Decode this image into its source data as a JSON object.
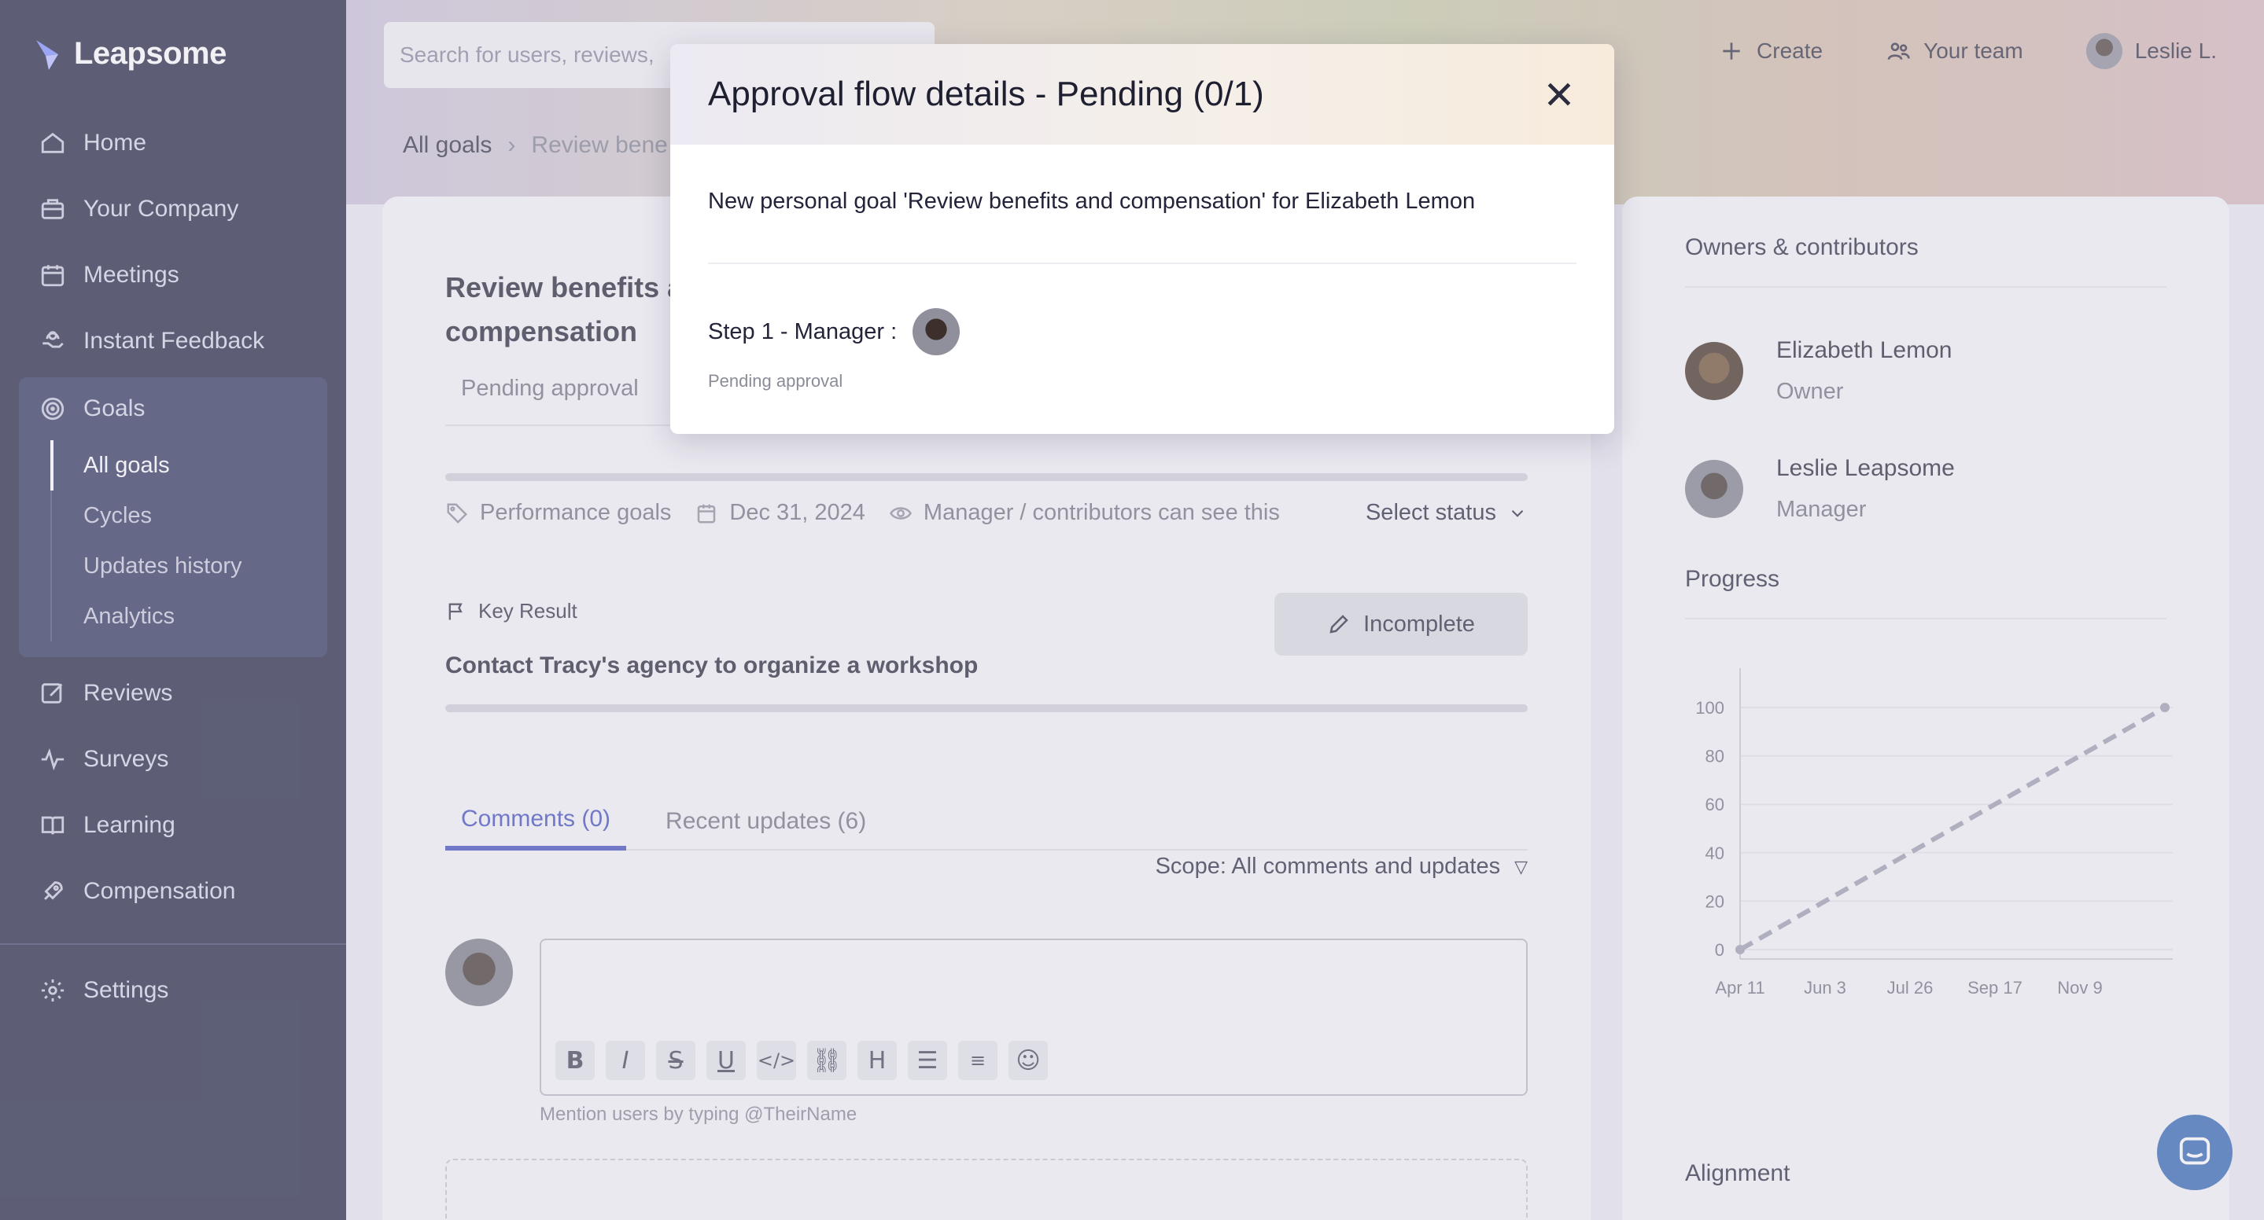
{
  "brand": {
    "name": "Leapsome"
  },
  "sidebar": {
    "items": [
      {
        "label": "Home",
        "icon": "home-icon"
      },
      {
        "label": "Your Company",
        "icon": "briefcase-icon"
      },
      {
        "label": "Meetings",
        "icon": "calendar-icon"
      },
      {
        "label": "Instant Feedback",
        "icon": "hand-icon"
      },
      {
        "label": "Goals",
        "icon": "target-icon"
      },
      {
        "label": "Reviews",
        "icon": "edit-icon"
      },
      {
        "label": "Surveys",
        "icon": "pulse-icon"
      },
      {
        "label": "Learning",
        "icon": "book-icon"
      },
      {
        "label": "Compensation",
        "icon": "rocket-icon"
      },
      {
        "label": "Settings",
        "icon": "gear-icon"
      }
    ],
    "goals_sub": [
      "All goals",
      "Cycles",
      "Updates history",
      "Analytics"
    ]
  },
  "header": {
    "search_placeholder": "Search for users, reviews,",
    "create": "Create",
    "your_team": "Your team",
    "user": "Leslie L."
  },
  "breadcrumb": {
    "root": "All goals",
    "current": "Review bene"
  },
  "goal": {
    "title": "Review benefits and compensation",
    "title_visible": "Review benefits ar compensation",
    "status_tab": "Pending approval",
    "meta": {
      "category": "Performance goals",
      "due_date": "Dec 31, 2024",
      "visibility": "Manager / contributors can see this",
      "select_status": "Select status"
    },
    "key_result": {
      "label": "Key Result",
      "title": "Contact Tracy's agency to organize a workshop",
      "button": "Incomplete"
    },
    "tabs": [
      {
        "label": "Comments (0)",
        "active": true
      },
      {
        "label": "Recent updates (6)",
        "active": false
      }
    ],
    "scope": "Scope: All comments and updates",
    "mention_hint": "Mention users by typing @TheirName"
  },
  "right_panel": {
    "owners_heading": "Owners & contributors",
    "people": [
      {
        "name": "Elizabeth Lemon",
        "role": "Owner"
      },
      {
        "name": "Leslie Leapsome",
        "role": "Manager"
      }
    ],
    "progress_heading": "Progress",
    "alignment_heading": "Alignment"
  },
  "chart_data": {
    "type": "line",
    "x": [
      "Apr 11",
      "Jun 3",
      "Jul 26",
      "Sep 17",
      "Nov 9"
    ],
    "yticks": [
      0,
      20,
      40,
      60,
      80,
      100
    ],
    "ylim": [
      0,
      100
    ],
    "series": [
      {
        "style": "dashed",
        "points": [
          {
            "x": "Apr 11",
            "y": 0
          },
          {
            "x": "Dec 31",
            "y": 100
          }
        ]
      }
    ],
    "color": "#9a9cae"
  },
  "modal": {
    "title": "Approval flow details - Pending (0/1)",
    "description": "New personal goal 'Review benefits and compensation' for Elizabeth Lemon",
    "step_label": "Step 1 - Manager :",
    "step_status": "Pending approval"
  }
}
